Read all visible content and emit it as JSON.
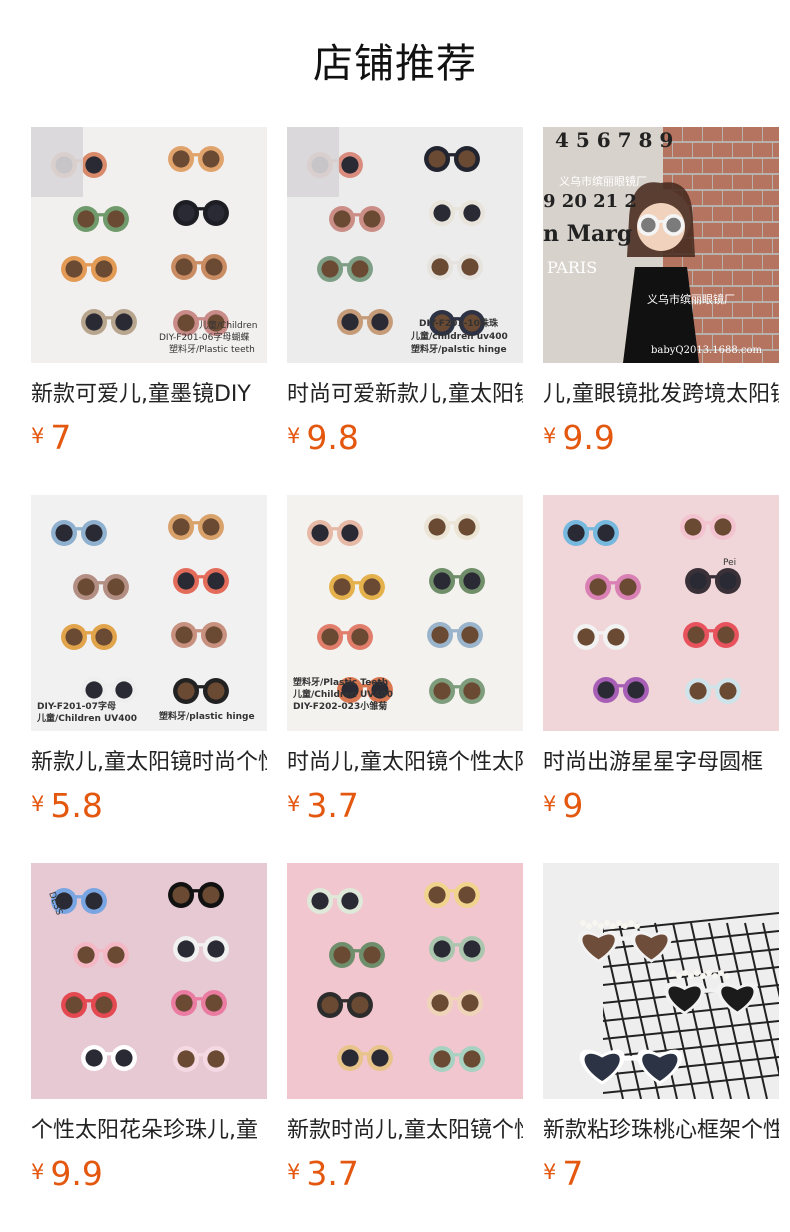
{
  "section_title": "店铺推荐",
  "currency_symbol": "¥",
  "accent_color": "#e4570f",
  "products": [
    {
      "name": "新款可爱儿,童墨镜DIY",
      "price": "7",
      "image_bg": "#f2f0ee",
      "image_text": [
        "儿童/Children",
        "DIY-F201-06字母蝴蝶",
        "塑料牙/Plastic teeth"
      ]
    },
    {
      "name": "时尚可爱新款儿,童太阳镜",
      "price": "9.8",
      "image_bg": "#ececec",
      "image_text": [
        "DIY-F201-10珠珠",
        "儿童/children uv400",
        "塑料牙/palstic hinge"
      ]
    },
    {
      "name": "儿,童眼镜批发跨境太阳镜",
      "price": "9.9",
      "image_bg": "#b9b2ac",
      "image_text": [
        "4 5 6 7 8 9",
        "义乌市缤丽眼镜厂",
        "9 20 21 2",
        "n Marg",
        "PARIS",
        "义乌市缤丽眼镜厂",
        "babyQ2013.1688.com"
      ]
    },
    {
      "name": "新款儿,童太阳镜时尚个性",
      "price": "5.8",
      "image_bg": "#f1f1f1",
      "image_text": [
        "DIY-F201-07字母",
        "儿童/Children UV400",
        "塑料牙/plastic hinge"
      ]
    },
    {
      "name": "时尚儿,童太阳镜个性太阳镜",
      "price": "3.7",
      "image_bg": "#f4f2ef",
      "image_text": [
        "塑料牙/Plastic Teeth",
        "儿童/Children UV400",
        "DIY-F202-023小雏菊"
      ]
    },
    {
      "name": "时尚出游星星字母圆框",
      "price": "9",
      "image_bg": "#f0d6d8",
      "image_text": [
        "Pei"
      ]
    },
    {
      "name": "个性太阳花朵珍珠儿,童",
      "price": "9.9",
      "image_bg": "#e6c9d2",
      "image_text": [
        "DESS"
      ]
    },
    {
      "name": "新款时尚儿,童太阳镜个性",
      "price": "3.7",
      "image_bg": "#f1c6cf",
      "image_text": []
    },
    {
      "name": "新款粘珍珠桃心框架个性",
      "price": "7",
      "image_bg": "#eeeeee",
      "image_text": []
    }
  ]
}
